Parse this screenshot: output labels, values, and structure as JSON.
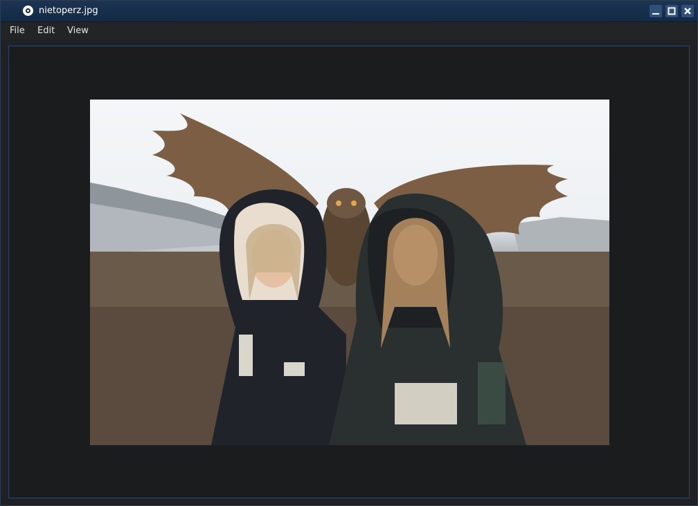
{
  "window": {
    "title": "nietoperz.jpg",
    "accent": "#132a45"
  },
  "icons": {
    "app": "app-icon",
    "minimize": "minimize-icon",
    "maximize": "maximize-icon",
    "close": "close-icon"
  },
  "menu": {
    "items": [
      {
        "label": "File"
      },
      {
        "label": "Edit"
      },
      {
        "label": "View"
      }
    ]
  },
  "image": {
    "description_name": "photo"
  }
}
